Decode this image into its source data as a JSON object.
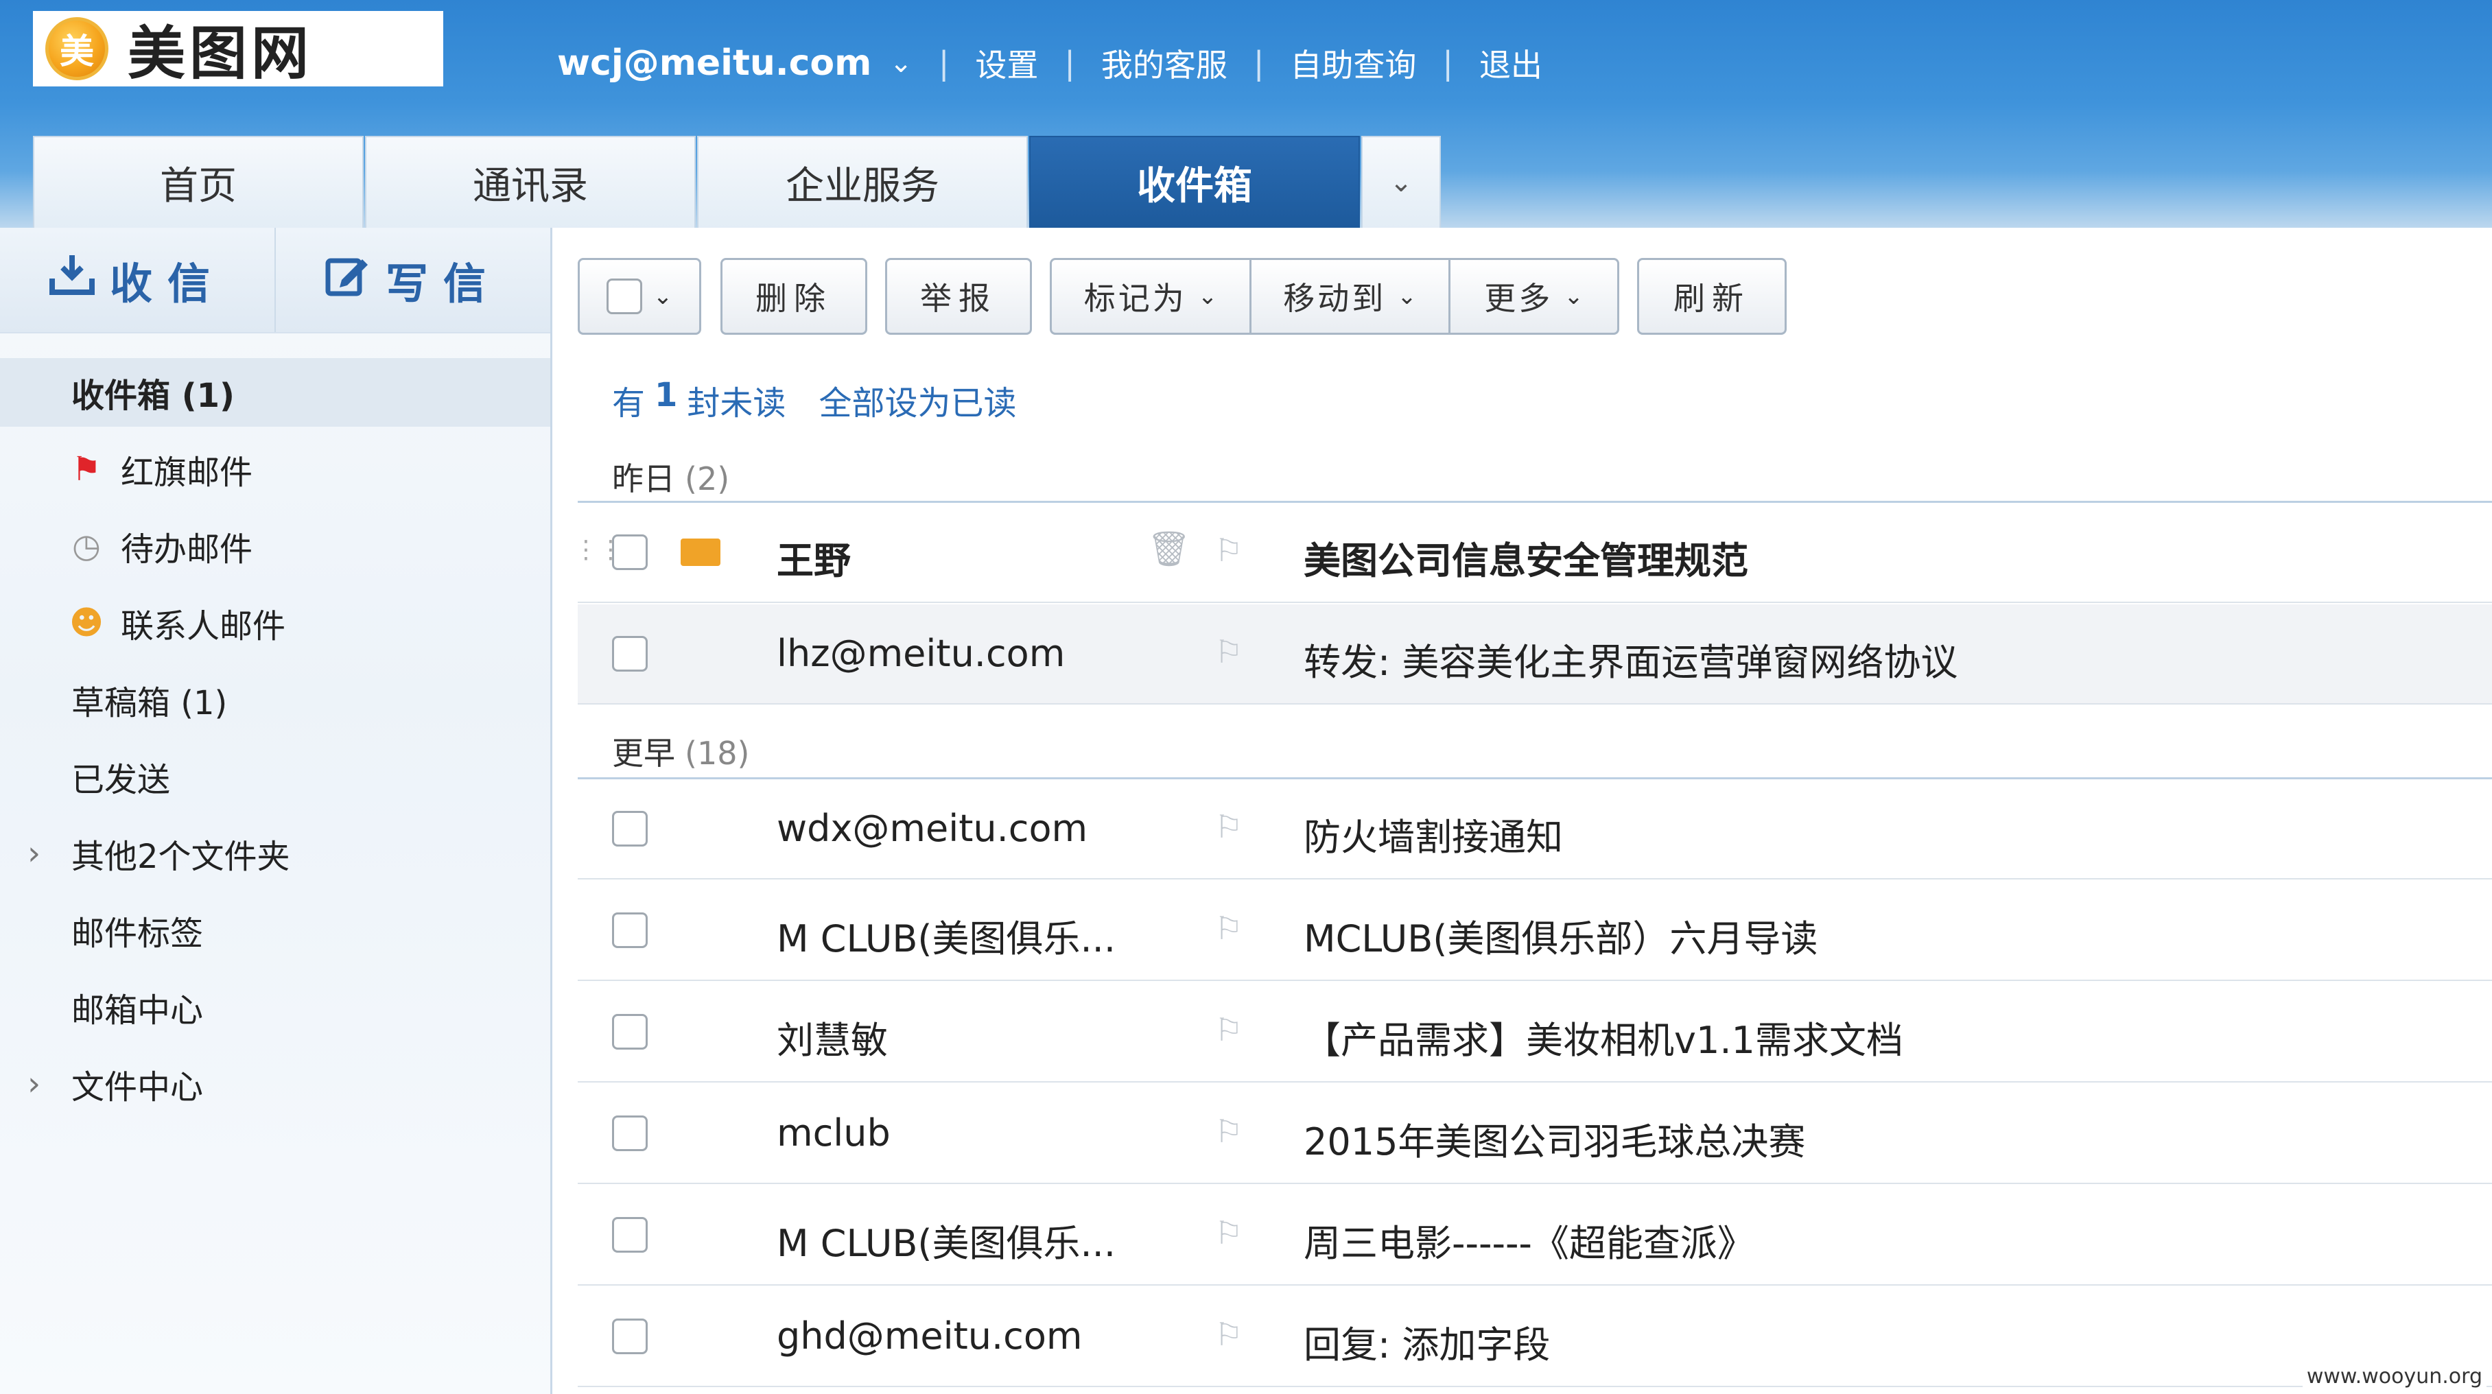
{
  "header": {
    "logo_mark": "美",
    "logo_text": "美图网",
    "account": "wcj@meitu.com",
    "links": [
      "设置",
      "我的客服",
      "自助查询",
      "退出"
    ]
  },
  "tabs": [
    {
      "label": "首页",
      "active": false
    },
    {
      "label": "通讯录",
      "active": false
    },
    {
      "label": "企业服务",
      "active": false
    },
    {
      "label": "收件箱",
      "active": true
    }
  ],
  "sidebar": {
    "receive_label": "收信",
    "compose_label": "写信",
    "folders": [
      {
        "label": "收件箱 (1)",
        "icon": "",
        "active": true
      },
      {
        "label": "红旗邮件",
        "icon": "red-flag-icon",
        "active": false
      },
      {
        "label": "待办邮件",
        "icon": "clock-icon",
        "active": false
      },
      {
        "label": "联系人邮件",
        "icon": "contact-icon",
        "active": false
      },
      {
        "label": "草稿箱 (1)",
        "icon": "",
        "active": false
      },
      {
        "label": "已发送",
        "icon": "",
        "active": false
      },
      {
        "label": "其他2个文件夹",
        "icon": "",
        "expandable": true,
        "active": false
      },
      {
        "label": "邮件标签",
        "icon": "",
        "active": false
      },
      {
        "label": "邮箱中心",
        "icon": "",
        "active": false
      },
      {
        "label": "文件中心",
        "icon": "",
        "expandable": true,
        "active": false
      }
    ]
  },
  "toolbar": {
    "delete_label": "删除",
    "report_label": "举报",
    "mark_as_label": "标记为",
    "move_to_label": "移动到",
    "more_label": "更多",
    "refresh_label": "刷新"
  },
  "unread_info": {
    "prefix": "有",
    "count": "1",
    "suffix": "封未读",
    "mark_all_label": "全部设为已读"
  },
  "groups": [
    {
      "name": "昨日",
      "count": "(2)",
      "messages": [
        {
          "sender": "王野",
          "subject": "美图公司信息安全管理规范",
          "unread": true
        },
        {
          "sender": "lhz@meitu.com",
          "subject": "转发: 美容美化主界面运营弹窗网络协议",
          "unread": false
        }
      ]
    },
    {
      "name": "更早",
      "count": "(18)",
      "messages": [
        {
          "sender": "wdx@meitu.com",
          "subject": "防火墙割接通知",
          "unread": false
        },
        {
          "sender": "M CLUB(美图俱乐...",
          "subject": "MCLUB(美图俱乐部）六月导读",
          "unread": false
        },
        {
          "sender": "刘慧敏",
          "subject": "【产品需求】美妆相机v1.1需求文档",
          "unread": false
        },
        {
          "sender": "mclub",
          "subject": "2015年美图公司羽毛球总决赛",
          "unread": false
        },
        {
          "sender": "M CLUB(美图俱乐...",
          "subject": "周三电影------《超能查派》",
          "unread": false
        },
        {
          "sender": "ghd@meitu.com",
          "subject": "回复: 添加字段",
          "unread": false
        }
      ]
    }
  ],
  "watermark": "www.wooyun.org",
  "colors": {
    "accent": "#1d5a9c",
    "link": "#2a6bb5",
    "unread_envelope": "#f0a328",
    "red_flag": "#e0242a"
  }
}
